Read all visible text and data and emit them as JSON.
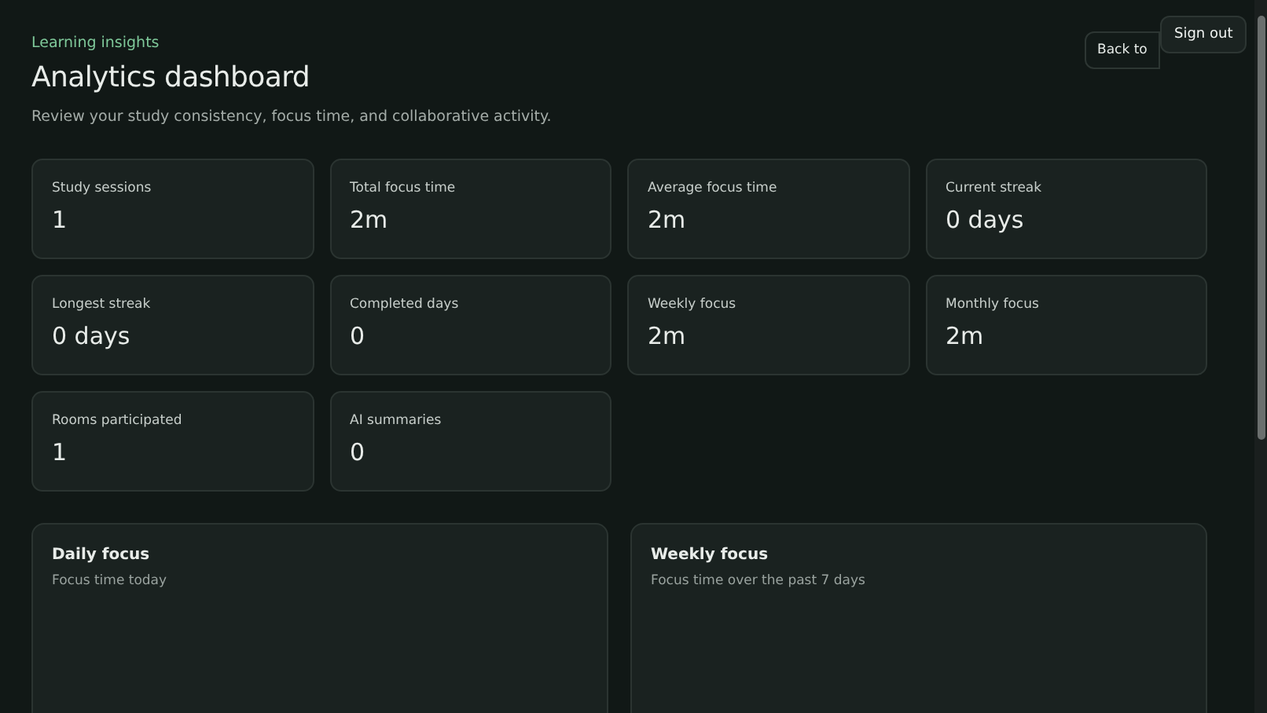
{
  "header": {
    "eyebrow": "Learning insights",
    "title": "Analytics dashboard",
    "subtitle": "Review your study consistency, focus time, and collaborative activity."
  },
  "buttons": [
    {
      "kind": "back",
      "label": "Back to"
    },
    {
      "kind": "signout",
      "label": "Sign out"
    }
  ],
  "stats": [
    {
      "label": "Study sessions",
      "value": "1"
    },
    {
      "label": "Total focus time",
      "value": "2m"
    },
    {
      "label": "Average focus time",
      "value": "2m"
    },
    {
      "label": "Current streak",
      "value": "0 days"
    },
    {
      "label": "Longest streak",
      "value": "0 days"
    },
    {
      "label": "Completed days",
      "value": "0"
    },
    {
      "label": "Weekly focus",
      "value": "2m"
    },
    {
      "label": "Monthly focus",
      "value": "2m"
    },
    {
      "label": "Rooms participated",
      "value": "1"
    },
    {
      "label": "AI summaries",
      "value": "0"
    }
  ],
  "panels": [
    {
      "title": "Daily focus",
      "subtitle": "Focus time today"
    },
    {
      "title": "Weekly focus",
      "subtitle": "Focus time over the past 7 days"
    }
  ]
}
